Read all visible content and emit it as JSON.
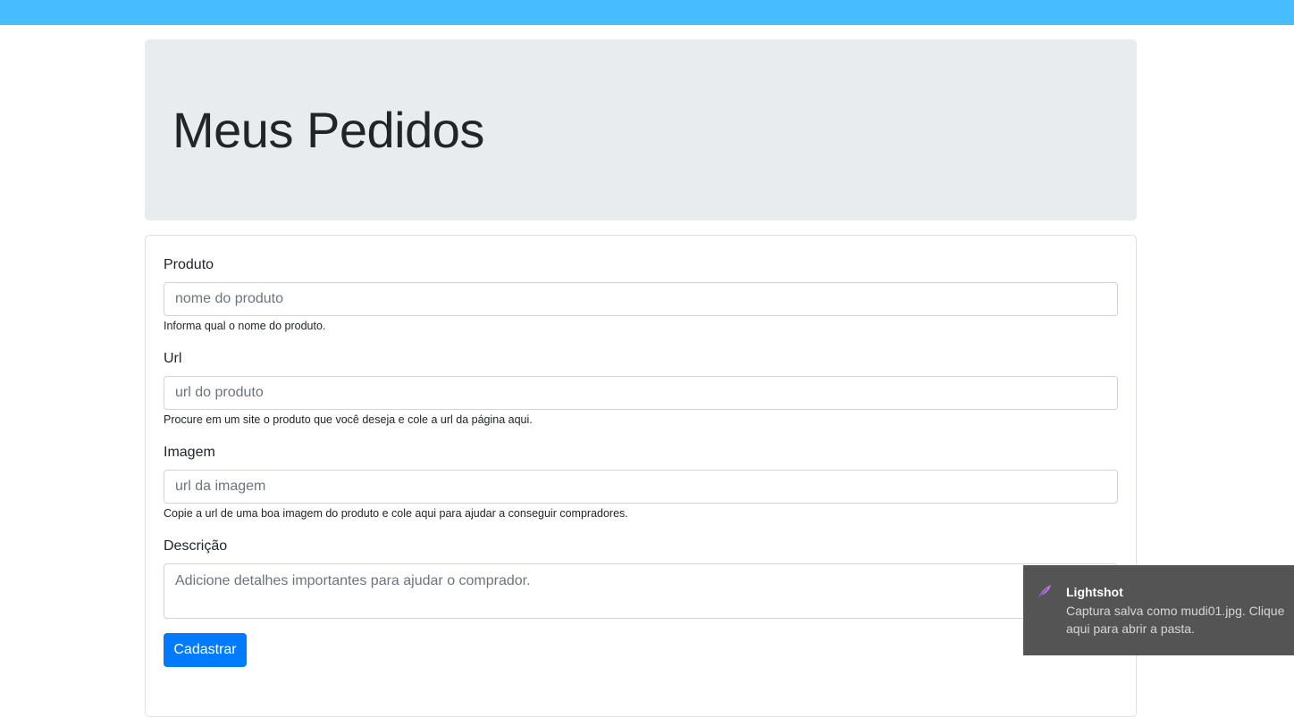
{
  "header": {
    "title": "Meus Pedidos"
  },
  "form": {
    "produto": {
      "label": "Produto",
      "placeholder": "nome do produto",
      "help": "Informa qual o nome do produto."
    },
    "url": {
      "label": "Url",
      "placeholder": "url do produto",
      "help": "Procure em um site o produto que você deseja e cole a url da página aqui."
    },
    "imagem": {
      "label": "Imagem",
      "placeholder": "url da imagem",
      "help": "Copie a url de uma boa imagem do produto e cole aqui para ajudar a conseguir compradores."
    },
    "descricao": {
      "label": "Descrição",
      "placeholder": "Adicione detalhes importantes para ajudar o comprador."
    },
    "submit_label": "Cadastrar"
  },
  "notification": {
    "icon": "feather-icon",
    "title": "Lightshot",
    "message": "Captura salva como mudi01.jpg. Clique aqui para abrir a pasta."
  },
  "colors": {
    "topbar": "#47bcff",
    "jumbotron": "#e9ecef",
    "primary": "#007bff",
    "toast_bg": "#545454"
  }
}
